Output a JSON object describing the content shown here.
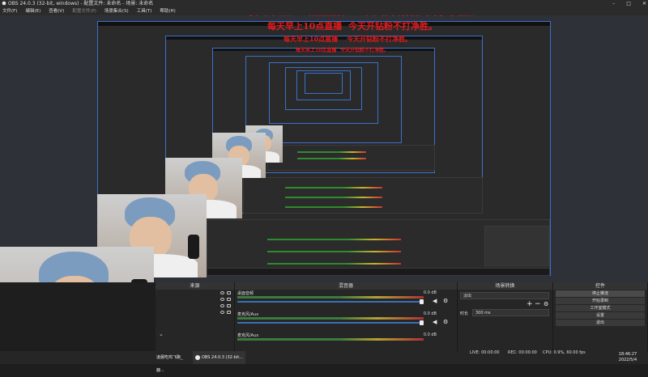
{
  "window": {
    "title": "OBS 24.0.3 (32-bit, windows) - 配置文件: 未命名 - 场景: 未命名"
  },
  "menu": [
    "文件(F)",
    "编辑(E)",
    "查看(V)",
    "配置文件(P)",
    "场景集合(S)",
    "工具(T)",
    "帮助(H)"
  ],
  "overlay": {
    "line1": "每天早上10点直播",
    "line2": "今天开钻粉不打净胜。"
  },
  "docks": {
    "scenes": {
      "title": "来源"
    },
    "mixer": {
      "title": "混音器",
      "channels": [
        {
          "name": "桌面音频",
          "db": "0.0 dB"
        },
        {
          "name": "麦克风/Aux",
          "db": "0.0 dB"
        },
        {
          "name": "麦克风/Aux",
          "db": "0.0 dB"
        }
      ]
    },
    "transitions": {
      "title": "场景转换",
      "type": "淡出",
      "duration_label": "时长",
      "duration_value": "300 ms"
    },
    "controls": {
      "title": "控件",
      "buttons": [
        "停止推流",
        "开始录制",
        "工作室模式",
        "设置",
        "退出"
      ]
    }
  },
  "status": {
    "live": "LIVE: 00:00:00",
    "rec": "REC: 00:00:00",
    "cpu": "CPU: 0.9%, 60.00 fps"
  },
  "taskbar": {
    "item1": "凌晨吃鸡飞跑_鹿...",
    "item2": "OBS 24.0.3 (32-bit...",
    "time": "18:46:27",
    "date": "2022/5/4"
  },
  "colors": {
    "accent": "#3b6fb6",
    "overlay_text": "#e31b1b",
    "background": "#1e1e1e"
  }
}
